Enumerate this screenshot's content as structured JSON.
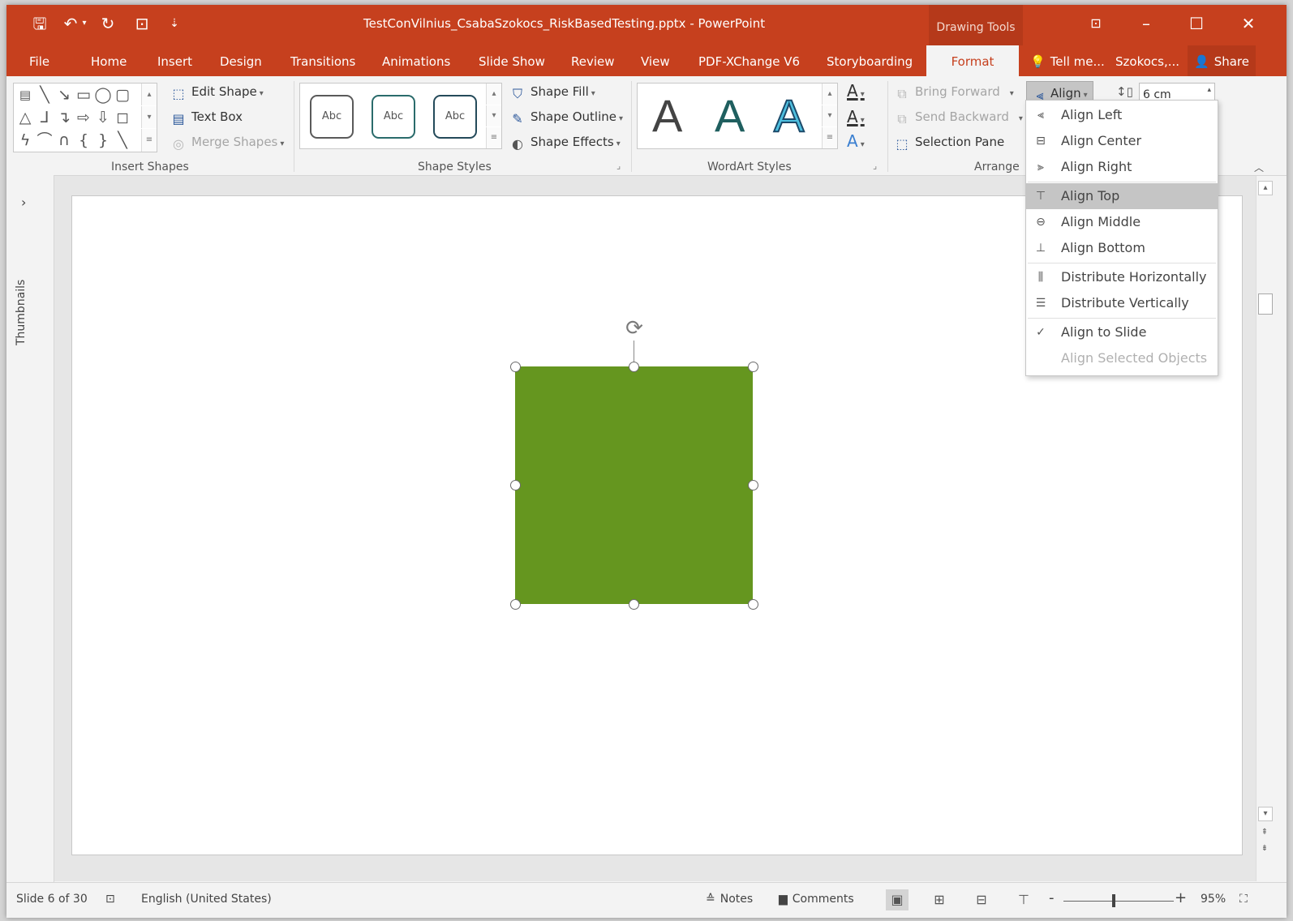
{
  "window": {
    "title": "TestConVilnius_CsabaSzokocs_RiskBasedTesting.pptx - PowerPoint",
    "contextual_tab_group": "Drawing Tools",
    "minimize_glyph": "–",
    "maximize_glyph": "☐",
    "close_glyph": "✕",
    "ribbon_display_glyph": "⊡"
  },
  "quick_access": {
    "save_glyph": "🖫",
    "undo_glyph": "↶",
    "redo_glyph": "↻",
    "present_glyph": "⊡",
    "customize_glyph": "⇣"
  },
  "tabs": [
    "File",
    "Home",
    "Insert",
    "Design",
    "Transitions",
    "Animations",
    "Slide Show",
    "Review",
    "View",
    "PDF-XChange V6",
    "Storyboarding",
    "Format"
  ],
  "tell_me": "Tell me...",
  "user": "Szokocs,...",
  "share": "Share",
  "ribbon": {
    "insert_shapes": {
      "label": "Insert Shapes",
      "edit_shape": "Edit Shape",
      "text_box": "Text Box",
      "merge_shapes": "Merge Shapes"
    },
    "shape_styles": {
      "label": "Shape Styles",
      "swatch_text": "Abc",
      "shape_fill": "Shape Fill",
      "shape_outline": "Shape Outline",
      "shape_effects": "Shape Effects"
    },
    "wordart_styles": {
      "label": "WordArt Styles",
      "letter": "A"
    },
    "arrange": {
      "label": "Arrange",
      "bring_forward": "Bring Forward",
      "send_backward": "Send Backward",
      "selection_pane": "Selection Pane",
      "align": "Align"
    },
    "size": {
      "height_value": "6 cm"
    }
  },
  "thumbnails_label": "Thumbnails",
  "align_menu": {
    "items": [
      {
        "label": "Align Left",
        "icon": "align-left-icon",
        "state": "normal"
      },
      {
        "label": "Align Center",
        "icon": "align-center-icon",
        "state": "normal"
      },
      {
        "label": "Align Right",
        "icon": "align-right-icon",
        "state": "normal"
      },
      {
        "label": "Align Top",
        "icon": "align-top-icon",
        "state": "highlighted"
      },
      {
        "label": "Align Middle",
        "icon": "align-middle-icon",
        "state": "normal"
      },
      {
        "label": "Align Bottom",
        "icon": "align-bottom-icon",
        "state": "normal"
      },
      {
        "label": "Distribute Horizontally",
        "icon": "distribute-horizontally-icon",
        "state": "normal"
      },
      {
        "label": "Distribute Vertically",
        "icon": "distribute-vertically-icon",
        "state": "normal"
      },
      {
        "label": "Align to Slide",
        "icon": "checkmark-icon",
        "state": "checked"
      },
      {
        "label": "Align Selected Objects",
        "icon": "",
        "state": "disabled"
      }
    ]
  },
  "status": {
    "slide": "Slide 6 of 30",
    "language": "English (United States)",
    "notes": "Notes",
    "comments": "Comments",
    "zoom_minus": "-",
    "zoom_plus": "+",
    "zoom": "95%"
  },
  "colors": {
    "accent": "#c6401e",
    "shape_fill": "#65961f",
    "menu_highlight": "#c5c5c5"
  }
}
